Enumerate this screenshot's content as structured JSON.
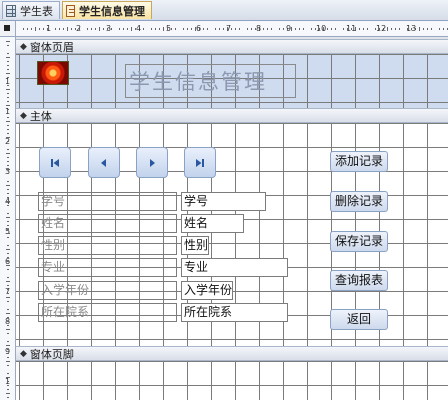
{
  "tabs": [
    {
      "label": "学生表",
      "icon": "table-icon",
      "active": false
    },
    {
      "label": "学生信息管理",
      "icon": "form-icon",
      "active": true
    }
  ],
  "ruler": {
    "h_numbers": [
      "1",
      "2",
      "3",
      "4",
      "5",
      "6",
      "7",
      "8",
      "9",
      "10",
      "11",
      "12",
      "13"
    ],
    "v_numbers": [
      "1",
      "1",
      "2",
      "3",
      "4",
      "5",
      "6",
      "7",
      "8",
      "9",
      "1"
    ]
  },
  "sections": {
    "header": "窗体页眉",
    "detail": "主体",
    "footer": "窗体页脚"
  },
  "header": {
    "title": "学生信息管理",
    "logo_icon": "flower-logo"
  },
  "nav": {
    "first": "first-record-icon",
    "prev": "previous-record-icon",
    "next": "next-record-icon",
    "last": "last-record-icon"
  },
  "buttons": {
    "add": "添加记录",
    "delete": "删除记录",
    "save": "保存记录",
    "query": "查询报表",
    "back": "返回"
  },
  "fields": [
    {
      "label": "学号",
      "value": "学号"
    },
    {
      "label": "姓名",
      "value": "姓名"
    },
    {
      "label": "性别",
      "value": "性别"
    },
    {
      "label": "专业",
      "value": "专业"
    },
    {
      "label": "入学年份",
      "value": "入学年份"
    },
    {
      "label": "所在院系",
      "value": "所在院系"
    }
  ],
  "colors": {
    "header_background": "#cfdcef",
    "active_tab": "#f9e3a2",
    "title_text": "#8c98b0"
  }
}
